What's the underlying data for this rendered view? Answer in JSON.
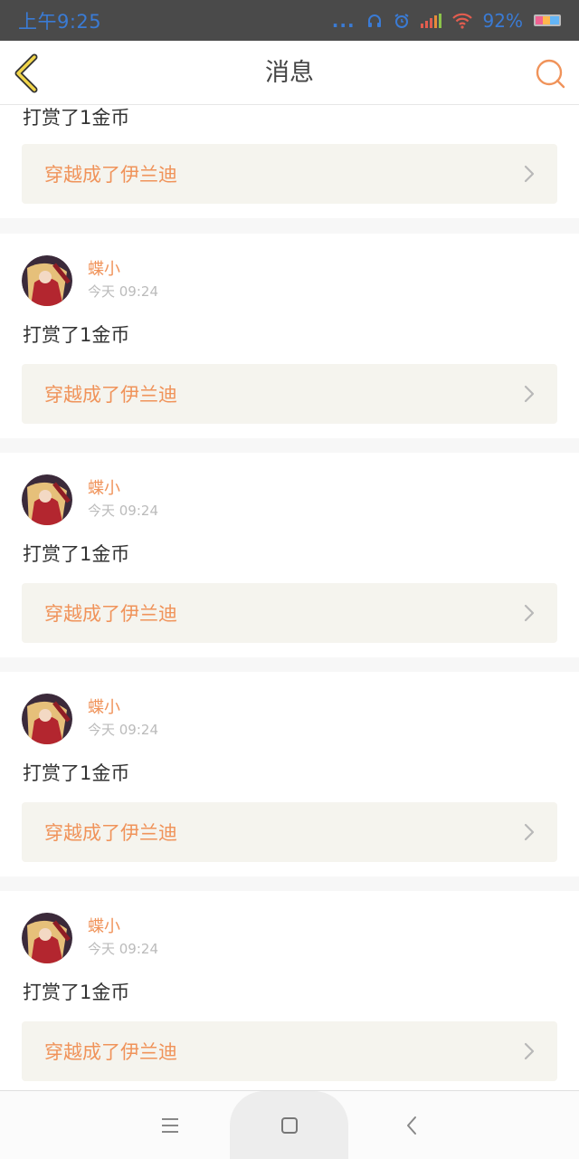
{
  "status_bar": {
    "time": "上午9:25",
    "dots": "...",
    "battery": "92%",
    "icons": [
      "headphones-icon",
      "alarm-icon",
      "signal-icon",
      "wifi-icon",
      "battery-icon"
    ]
  },
  "header": {
    "title": "消息",
    "back_icon": "chevron-left-icon",
    "search_icon": "search-icon",
    "accent_color": "#f0935a"
  },
  "partial_message": {
    "text": "打赏了1金币",
    "link_label": "穿越成了伊兰迪"
  },
  "messages": [
    {
      "user": "蝶小",
      "time": "今天 09:24",
      "text": "打赏了1金币",
      "link_label": "穿越成了伊兰迪"
    },
    {
      "user": "蝶小",
      "time": "今天 09:24",
      "text": "打赏了1金币",
      "link_label": "穿越成了伊兰迪"
    },
    {
      "user": "蝶小",
      "time": "今天 09:24",
      "text": "打赏了1金币",
      "link_label": "穿越成了伊兰迪"
    },
    {
      "user": "蝶小",
      "time": "今天 09:24",
      "text": "打赏了1金币",
      "link_label": "穿越成了伊兰迪"
    }
  ],
  "nav_bar": {
    "icons": [
      "menu-icon",
      "home-square-icon",
      "back-arrow-icon"
    ]
  }
}
